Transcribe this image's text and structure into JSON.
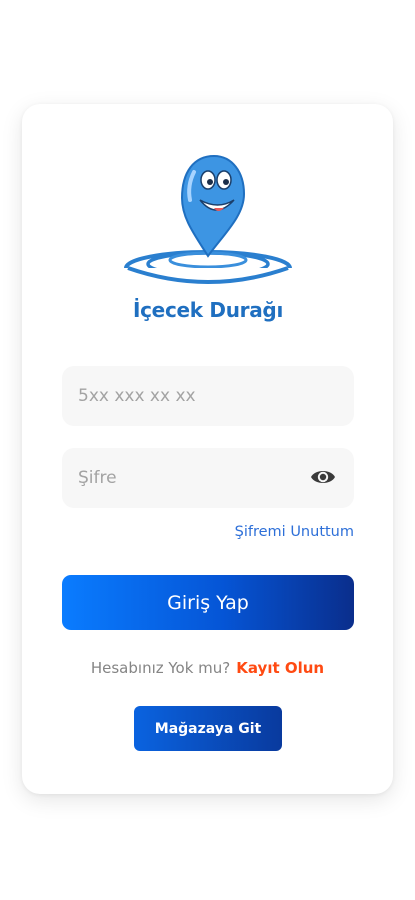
{
  "brand": {
    "name": "İçecek Durağı",
    "logo_icon": "water-drop-mascot-icon",
    "brand_color": "#1f6fc0"
  },
  "login": {
    "phone_placeholder": "5xx xxx xx xx",
    "phone_value": "",
    "password_placeholder": "Şifre",
    "password_value": "",
    "show_password_icon": "eye-icon",
    "forgot_password_label": "Şifremi Unuttum",
    "submit_label": "Giriş Yap"
  },
  "signup": {
    "question": "Hesabınız Yok mu?",
    "link_label": "Kayıt Olun",
    "link_color": "#ff4a12"
  },
  "store": {
    "button_label": "Mağazaya Git"
  },
  "colors": {
    "primary_gradient_start": "#0a7cff",
    "primary_gradient_end": "#0a2e8c",
    "link_blue": "#2d6fd8"
  }
}
